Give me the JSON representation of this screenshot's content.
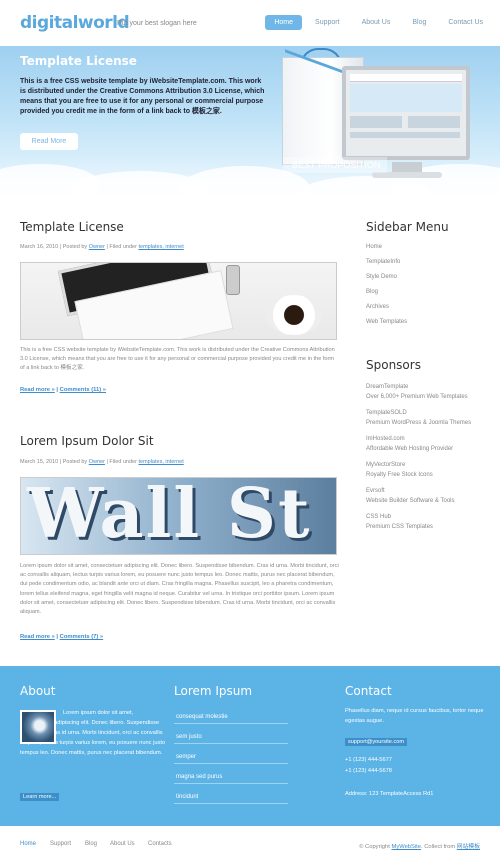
{
  "header": {
    "logo": "digitalworld",
    "slogan": "Put your best slogan here",
    "nav": [
      {
        "label": "Home",
        "active": true
      },
      {
        "label": "Support",
        "active": false
      },
      {
        "label": "About Us",
        "active": false
      },
      {
        "label": "Blog",
        "active": false
      },
      {
        "label": "Contact Us",
        "active": false
      }
    ]
  },
  "banner": {
    "title": "Template License",
    "text": "This is a free CSS website template by iWebsiteTemplate.com. This work is distributed under the Creative Commons Attribution 3.0 License, which means that you are free to use it for any personal or commercial purpose provided you credit me in the form of a link back to 模板之家.",
    "read_more": "Read More",
    "proposition": "BEST PROPOSITION"
  },
  "posts": [
    {
      "title": "Template License",
      "date": "March 16, 2010",
      "posted_by_prefix": "Posted by",
      "author": "Owner",
      "filed_under_prefix": "Filed under",
      "categories": "templates, internet",
      "text": "This is a free CSS website template by iWebsiteTemplate.com. This work is distributed under the Creative Commons Attribution 3.0 License, which means that you are free to use it for any personal or commercial purpose provided you credit me in the form of a link back to 模板之家.",
      "read_more": "Read more »",
      "comments": "Comments (11) »"
    },
    {
      "title": "Lorem Ipsum Dolor Sit",
      "date": "March 15, 2010",
      "posted_by_prefix": "Posted by",
      "author": "Owner",
      "filed_under_prefix": "Filed under",
      "categories": "templates, internet",
      "image_text": "Wall St",
      "text": "Lorem ipsum dolor sit amet, consectetuer adipiscing elit. Donec libero. Suspendisse bibendum. Cras id urna. Morbi tincidunt, orci ac convallis aliquam, lectus turpis varius lorem, eu posuere nunc justo tempus leo. Donec mattis, purus nec placerat bibendum, dui pede condimentum odio, ac blandit ante orci ut diam. Cras fringilla magna. Phasellus suscipit, leo a pharetra condimentum, lorem tellus eleifend magna, eget fringilla velit magna id neque. Curabitur vel urna. In tristique orci porttitor ipsum. Lorem ipsum dolor sit amet, consectetuer adipiscing elit. Donec libero. Suspendisse bibendum. Cras id urna. Morbi tincidunt, orci ac convallis aliquam.",
      "read_more": "Read more »",
      "comments": "Comments (7) »"
    }
  ],
  "sidebar": {
    "menu_title": "Sidebar Menu",
    "menu": [
      "Home",
      "TemplateInfo",
      "Style Demo",
      "Blog",
      "Archives",
      "Web Templates"
    ],
    "sponsors_title": "Sponsors",
    "sponsors": [
      {
        "name": "DreamTemplate",
        "desc": "Over 6,000+ Premium Web Templates"
      },
      {
        "name": "TemplateSOLD",
        "desc": "Premium WordPress & Joomla Themes"
      },
      {
        "name": "ImHosted.com",
        "desc": "Affordable Web Hosting Provider"
      },
      {
        "name": "MyVectorStore",
        "desc": "Royalty Free Stock Icons"
      },
      {
        "name": "Evrsoft",
        "desc": "Website Builder Software & Tools"
      },
      {
        "name": "CSS Hub",
        "desc": "Premium CSS Templates"
      }
    ]
  },
  "footer": {
    "about_title": "About",
    "about_text": "Lorem ipsum dolor sit amet, consectetuer adipiscing elit. Donec libero. Suspendisse bibendum. Cras id urna. Morbi tincidunt, orci ac convallis aliquam, lectus turpis varius lorem, eu posuere nunc justo tempus leo. Donec mattis, purus nec placerat bibendum.",
    "about_more": "Learn more...",
    "lorem_title": "Lorem Ipsum",
    "lorem_items": [
      "consequat molestie",
      "sem justo",
      "semper",
      "magna sed purus",
      "tincidunt"
    ],
    "contact_title": "Contact",
    "contact_text": "Phasellus diam, neque id cursus faucibus, tortor neque egestas augue.",
    "email": "support@yoursite.com",
    "phone1": "+1 (123) 444-5677",
    "phone2": "+1 (123) 444-5678",
    "address": "Address: 123 TemplateAccess Rd1"
  },
  "bottom": {
    "links": [
      "Home",
      "Support",
      "Blog",
      "About Us",
      "Contacts"
    ],
    "copyright_prefix": "© Copyright",
    "copyright_link": "MyWebSite",
    "collect_prefix": ". Collect from",
    "collect_link": "网站模板"
  }
}
